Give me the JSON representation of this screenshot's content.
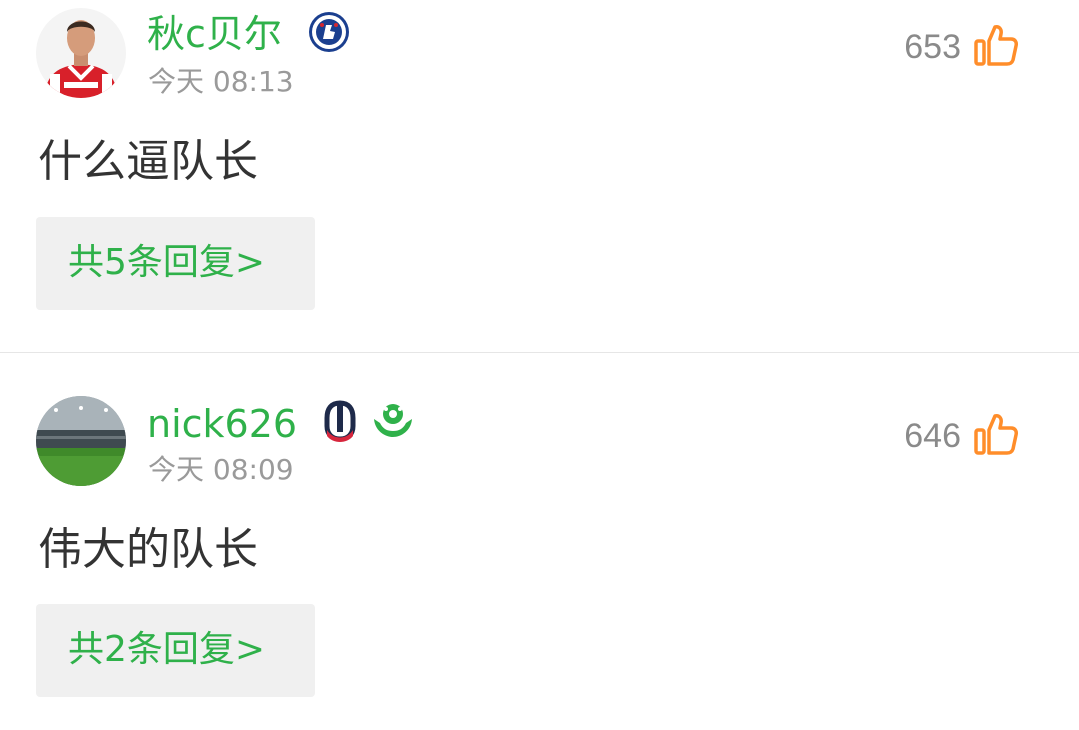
{
  "theme": {
    "username_color": "#2fb14a",
    "reply_link_color": "#2fb14a",
    "like_icon_color": "#ff8d2a",
    "count_color": "#8a8a8a",
    "time_color": "#9a9a9a",
    "content_color": "#333333",
    "reply_bg": "#f0f0f0"
  },
  "comments": [
    {
      "username": "秋c贝尔",
      "avatar": "player-avatar",
      "badges": [
        "chelsea-crest-icon"
      ],
      "time": "今天 08:13",
      "likes": "653",
      "text": "什么逼队长",
      "replies_label": "共5条回复>"
    },
    {
      "username": "nick626",
      "avatar": "stadium-avatar",
      "badges": [
        "league-logo-icon",
        "football-hands-icon"
      ],
      "time": "今天 08:09",
      "likes": "646",
      "text": "伟大的队长",
      "replies_label": "共2条回复>"
    }
  ]
}
